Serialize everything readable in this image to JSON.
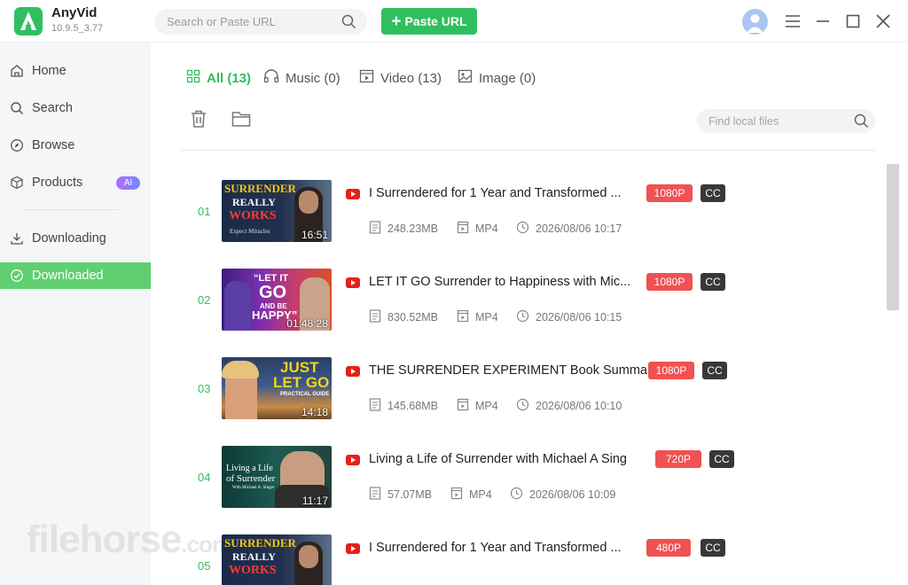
{
  "app": {
    "name": "AnyVid",
    "version": "10.9.5_3.77",
    "search_placeholder": "Search or Paste URL",
    "paste_url_label": "Paste URL"
  },
  "sidebar": {
    "items": [
      {
        "label": "Home",
        "icon": "home-icon"
      },
      {
        "label": "Search",
        "icon": "search-icon"
      },
      {
        "label": "Browse",
        "icon": "compass-icon"
      },
      {
        "label": "Products",
        "icon": "cube-icon",
        "badge": "AI"
      },
      {
        "label": "Downloading",
        "icon": "download-icon"
      },
      {
        "label": "Downloaded",
        "icon": "check-circle-icon",
        "active": true
      }
    ]
  },
  "tabs": [
    {
      "label": "All (13)",
      "icon": "grid-icon",
      "active": true
    },
    {
      "label": "Music (0)",
      "icon": "headphones-icon"
    },
    {
      "label": "Video (13)",
      "icon": "video-icon"
    },
    {
      "label": "Image (0)",
      "icon": "image-icon"
    }
  ],
  "find_placeholder": "Find local files",
  "downloads": [
    {
      "index": "01",
      "title": "I Surrendered for 1 Year and Transformed ...",
      "resolution": "1080P",
      "cc": "CC",
      "size": "248.23MB",
      "format": "MP4",
      "date": "2026/08/06 10:17",
      "duration": "16:51",
      "thumb_text": [
        "SURRENDER",
        "REALLY",
        "WORKS",
        "Expect Miracles"
      ]
    },
    {
      "index": "02",
      "title": "LET IT GO Surrender to Happiness with Mic...",
      "resolution": "1080P",
      "cc": "CC",
      "size": "830.52MB",
      "format": "MP4",
      "date": "2026/08/06 10:15",
      "duration": "01:48:28",
      "thumb_text": [
        "“LET IT",
        "GO",
        "AND BE",
        "HAPPY”"
      ]
    },
    {
      "index": "03",
      "title": "THE SURRENDER EXPERIMENT Book Summar...",
      "resolution": "1080P",
      "cc": "CC",
      "size": "145.68MB",
      "format": "MP4",
      "date": "2026/08/06 10:10",
      "duration": "14:18",
      "thumb_text": [
        "JUST",
        "LET GO",
        "PRACTICAL GUIDE"
      ]
    },
    {
      "index": "04",
      "title": "Living a Life of Surrender with Michael A Sing",
      "resolution": "720P",
      "cc": "CC",
      "size": "57.07MB",
      "format": "MP4",
      "date": "2026/08/06 10:09",
      "duration": "11:17",
      "thumb_text": [
        "Living a Life",
        "of Surrender",
        "With Michael A. Singer"
      ]
    },
    {
      "index": "05",
      "title": "I Surrendered for 1 Year and Transformed ...",
      "resolution": "480P",
      "cc": "CC",
      "size": "",
      "format": "",
      "date": "",
      "duration": "",
      "thumb_text": [
        "SURRENDER",
        "REALLY",
        "WORKS"
      ]
    }
  ],
  "watermark": {
    "main": "filehorse",
    "suffix": ".com"
  },
  "colors": {
    "accent": "#2fbf5f",
    "sidebar_active": "#5fcf6f",
    "resolution_badge": "#f05152",
    "cc_badge": "#383838"
  }
}
